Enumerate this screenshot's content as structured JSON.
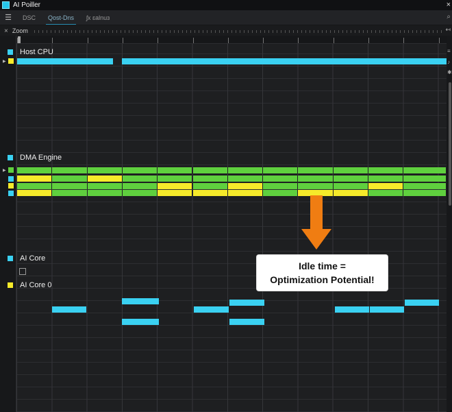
{
  "window": {
    "title": "AI Poiller",
    "close_glyph": "×"
  },
  "menu": {
    "tabs": [
      {
        "label": "DSC"
      },
      {
        "label": "Qost-Dns"
      },
      {
        "label": "ʃx ɛalnuɜ"
      }
    ],
    "active_tab": 1
  },
  "zoom": {
    "close_glyph": "×",
    "label": "Zoom"
  },
  "sections": {
    "host_cpu": {
      "label": "Host CPU"
    },
    "dma_engine": {
      "label": "DMA Engine"
    },
    "ai_core": {
      "label": "AI Core"
    },
    "ai_core_0": {
      "label": "AI Core 0"
    }
  },
  "callout": {
    "line1": "Idle time =",
    "line2": "Optimization Potential!"
  },
  "colors": {
    "cyan": "#3ad1f2",
    "green": "#5fd03e",
    "yellow": "#f6ea2a",
    "orange": "#f07d12"
  },
  "icons": {
    "menu": "hamburger-icon",
    "close": "close-icon",
    "expand": "expand-arrow-icon"
  }
}
